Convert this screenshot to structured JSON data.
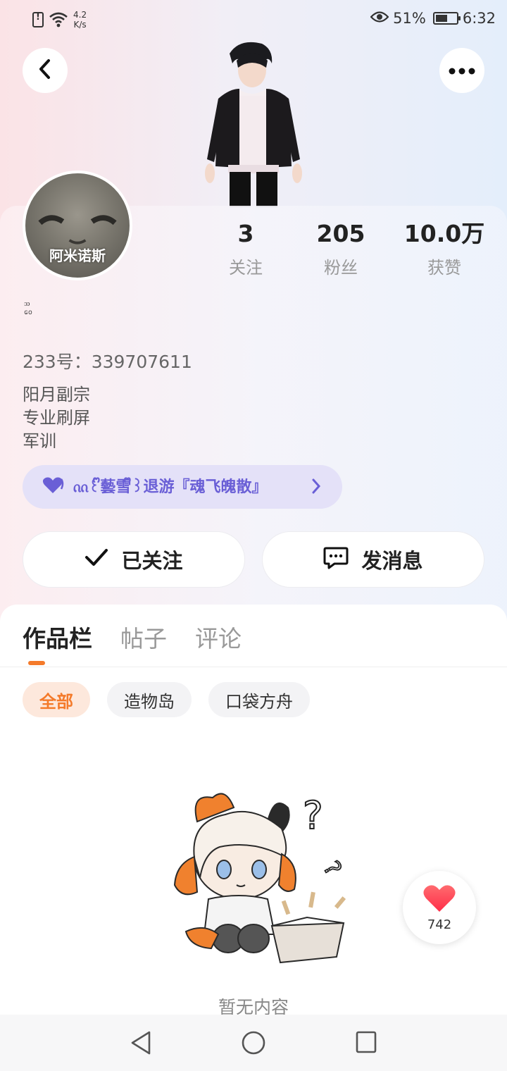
{
  "status_bar": {
    "net_speed": "4.2",
    "net_speed_unit": "K/s",
    "battery_percent": "51%",
    "time": "6:32"
  },
  "profile": {
    "avatar_label": "阿米诺斯",
    "uid": "233号：339707611",
    "bio_lines": [
      "阳月副宗",
      "专业刷屏",
      "军训"
    ],
    "guild": "ᦶ꒰ᩚ藝雪ᩚ꒱退游『魂飞魄散』",
    "tiny_mark_lines": [
      "ᦉ",
      "ᩅᩮ"
    ]
  },
  "stats": [
    {
      "value": "3",
      "label": "关注"
    },
    {
      "value": "205",
      "label": "粉丝"
    },
    {
      "value": "10.0万",
      "label": "获赞"
    }
  ],
  "actions": {
    "follow_label": "已关注",
    "message_label": "发消息"
  },
  "tabs": [
    "作品栏",
    "帖子",
    "评论"
  ],
  "filters": [
    "全部",
    "造物岛",
    "口袋方舟"
  ],
  "empty_text": "暂无内容",
  "like": {
    "count": "742"
  },
  "colors": {
    "accent": "#f47a2a",
    "guild_text": "#6a5fd6",
    "guild_bg": "#e4e1f8",
    "heart": "#ff4d5a"
  },
  "icons": {
    "back": "chevron-left-icon",
    "more": "more-dots-icon",
    "follow": "check-icon",
    "message": "chat-bubble-icon",
    "guild": "heart-icon",
    "like": "heart-icon"
  }
}
